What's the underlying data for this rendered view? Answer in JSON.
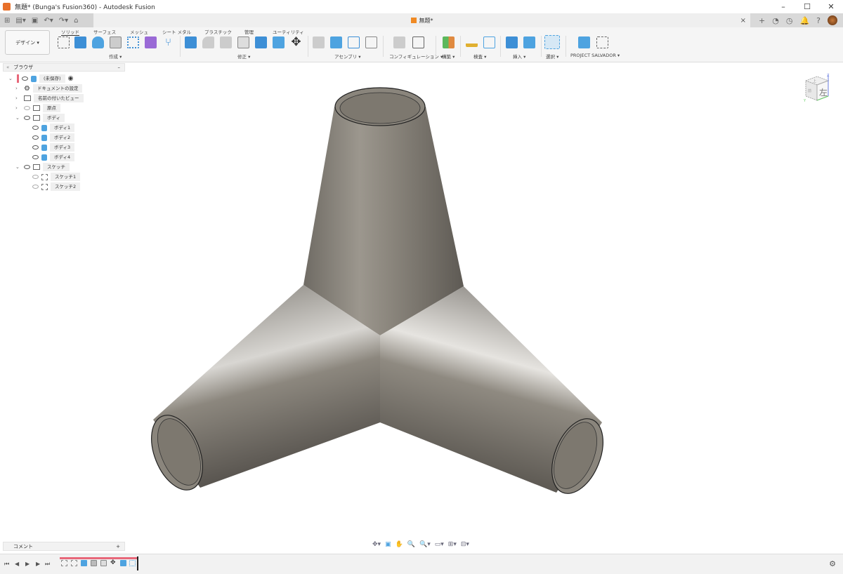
{
  "window": {
    "title": "無題* (Bunga's Fusion360) - Autodesk Fusion",
    "minimize": "–",
    "maximize": "☐",
    "close": "✕"
  },
  "tabs": {
    "doc_title": "無題*",
    "close": "×",
    "new": "+"
  },
  "quick_access": {
    "grid": "⊞",
    "file": "▤▾",
    "save": "▣",
    "undo": "↶▾",
    "redo": "↷▾",
    "home": "⌂"
  },
  "top_right": {
    "jobs": "◔",
    "history": "◷",
    "notify": "🔔",
    "help": "?"
  },
  "ribbon": {
    "workspace": "デザイン ▾",
    "tabs": [
      "ソリッド",
      "サーフェス",
      "メッシュ",
      "シート メタル",
      "プラスチック",
      "管理",
      "ユーティリティ"
    ],
    "groups": [
      "作成 ▾",
      "修正 ▾",
      "アセンブリ ▾",
      "コンフィギュレーション ▾",
      "構築 ▾",
      "検査 ▾",
      "挿入 ▾",
      "選択 ▾",
      "PROJECT SALVADOR ▾"
    ]
  },
  "browser": {
    "title": "ブラウザ",
    "collapse": "«",
    "minimize": "–",
    "root": "(未保存)",
    "items": [
      {
        "label": "ドキュメントの設定"
      },
      {
        "label": "名前の付いたビュー"
      },
      {
        "label": "原点"
      },
      {
        "label": "ボディ"
      },
      {
        "label": "ボディ1"
      },
      {
        "label": "ボディ2"
      },
      {
        "label": "ボディ3"
      },
      {
        "label": "ボディ4"
      },
      {
        "label": "スケッチ"
      },
      {
        "label": "スケッチ1"
      },
      {
        "label": "スケッチ2"
      }
    ]
  },
  "viewcube": {
    "face": "左",
    "top": "上",
    "front": "前",
    "z": "Z",
    "y": "Y"
  },
  "comment": {
    "label": "コメント",
    "add": "+"
  },
  "playback": {
    "first": "⏮",
    "prev": "◀",
    "play": "▶",
    "next": "▶",
    "last": "⏭"
  },
  "navbar": [
    "✥▾",
    "▣",
    "✋",
    "🔍",
    "🔍▾",
    "▭▾",
    "⊞▾",
    "⊟▾"
  ],
  "settings": "⚙",
  "colors": {
    "accent": "#e8687a",
    "body": "#4ea3e0",
    "model": "#8a857c"
  }
}
